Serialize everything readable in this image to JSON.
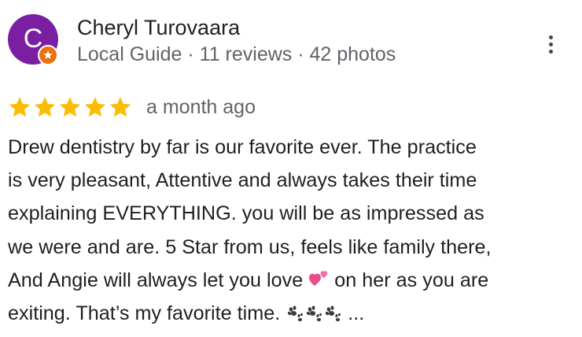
{
  "reviewer": {
    "initial": "C",
    "name": "Cheryl Turovaara",
    "meta": "Local Guide · 11 reviews · 42 photos",
    "avatar_color": "#7b1fa2",
    "badge_color": "#e8710a",
    "badge_icon": "local-guide-star-icon"
  },
  "menu": {
    "icon": "more-vert-icon"
  },
  "rating": {
    "stars": 5,
    "max_stars": 5,
    "star_color": "#fbbc04",
    "date": "a month ago"
  },
  "review": {
    "lines": [
      "Drew dentistry by far is our favorite ever. The practice",
      "is very pleasant, Attentive and always takes their time",
      "explaining EVERYTHING. you will be as impressed as",
      "we were and are. 5 Star from us, feels like family there,"
    ],
    "line5_before": "And Angie will always let you love ",
    "line5_after": " on her as you are",
    "line6_text": "exiting. That’s my favorite time. ",
    "ellipsis": " ...",
    "emoji_heart": "two-hearts-icon",
    "emoji_paws": "paw-prints-icon",
    "paw_count": 3
  }
}
